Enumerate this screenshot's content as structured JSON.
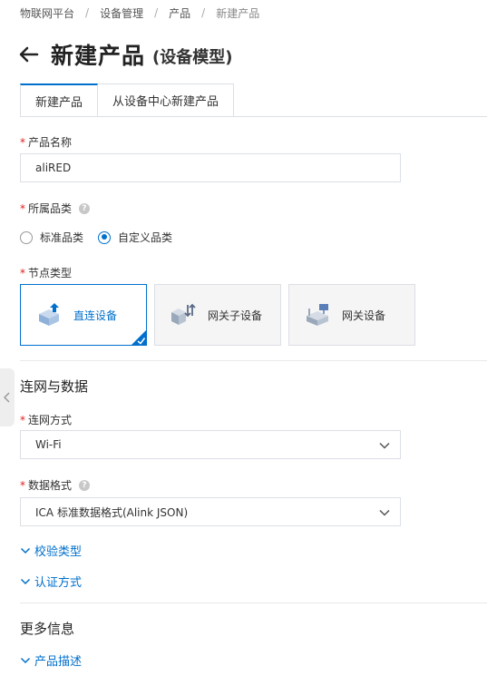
{
  "breadcrumb": {
    "items": [
      "物联网平台",
      "设备管理",
      "产品",
      "新建产品"
    ]
  },
  "header": {
    "title": "新建产品",
    "subtitle": "(设备模型)"
  },
  "tabs": [
    {
      "label": "新建产品",
      "active": true
    },
    {
      "label": "从设备中心新建产品",
      "active": false
    }
  ],
  "form": {
    "product_name": {
      "label": "产品名称",
      "value": "aliRED",
      "required": true
    },
    "category": {
      "label": "所属品类",
      "required": true,
      "options": [
        {
          "label": "标准品类",
          "checked": false
        },
        {
          "label": "自定义品类",
          "checked": true
        }
      ]
    },
    "node_type": {
      "label": "节点类型",
      "required": true,
      "options": [
        {
          "label": "直连设备",
          "selected": true,
          "icon": "direct-device-icon"
        },
        {
          "label": "网关子设备",
          "selected": false,
          "icon": "gateway-subdevice-icon"
        },
        {
          "label": "网关设备",
          "selected": false,
          "icon": "gateway-device-icon"
        }
      ]
    }
  },
  "network_section": {
    "title": "连网与数据",
    "connection": {
      "label": "连网方式",
      "value": "Wi-Fi",
      "required": true
    },
    "data_format": {
      "label": "数据格式",
      "value": "ICA 标准数据格式(Alink JSON)",
      "required": true
    },
    "verify_type": "校验类型",
    "auth_method": "认证方式"
  },
  "more_section": {
    "title": "更多信息",
    "product_desc": "产品描述"
  },
  "colors": {
    "accent": "#0070cc",
    "required": "#e02020",
    "border": "#dcdfe6"
  }
}
